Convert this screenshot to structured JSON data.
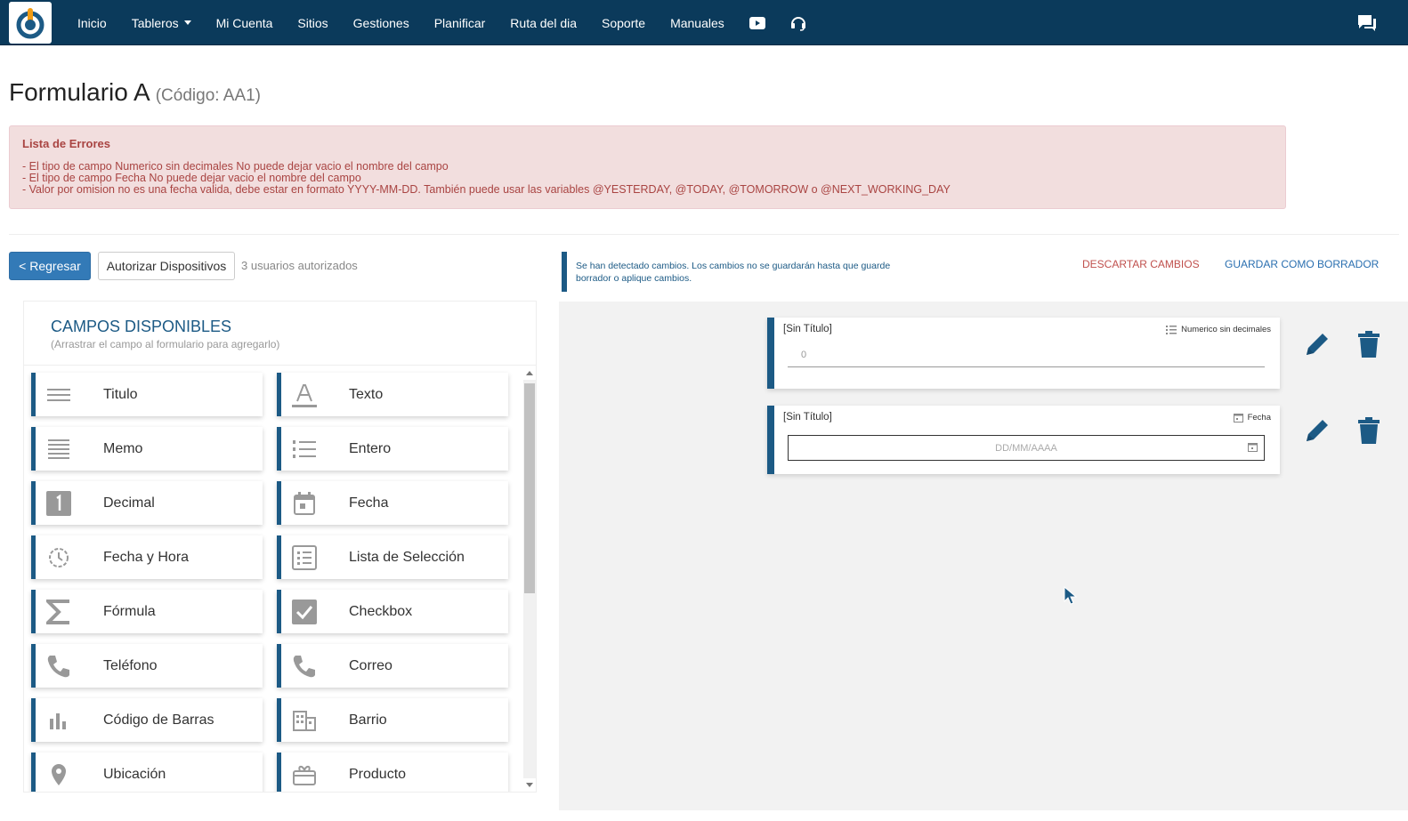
{
  "nav": {
    "items": [
      {
        "label": "Inicio"
      },
      {
        "label": "Tableros"
      },
      {
        "label": "Mi Cuenta"
      },
      {
        "label": "Sitios"
      },
      {
        "label": "Gestiones"
      },
      {
        "label": "Planificar"
      },
      {
        "label": "Ruta del dia"
      },
      {
        "label": "Soporte"
      },
      {
        "label": "Manuales"
      }
    ],
    "icons": [
      "youtube-icon",
      "headset-icon",
      "chat-icon"
    ]
  },
  "page": {
    "title": "Formulario A",
    "code": "(Código: AA1)"
  },
  "errors": {
    "title": "Lista de Errores",
    "lines": [
      "- El tipo de campo Numerico sin decimales No puede dejar vacio el nombre del campo",
      "- El tipo de campo Fecha No puede dejar vacio el nombre del campo",
      "- Valor por omision no es una fecha valida, debe estar en formato YYYY-MM-DD. También puede usar las variables @YESTERDAY, @TODAY, @TOMORROW o @NEXT_WORKING_DAY"
    ]
  },
  "toolbar": {
    "back_label": "< Regresar",
    "auth_label": "Autorizar Dispositivos",
    "auth_count": "3 usuarios autorizados"
  },
  "panel": {
    "title": "CAMPOS DISPONIBLES",
    "subtitle": "(Arrastrar el campo al formulario para agregarlo)",
    "fields": [
      {
        "label": "Titulo",
        "icon": "lines-icon"
      },
      {
        "label": "Texto",
        "icon": "text-a-icon"
      },
      {
        "label": "Memo",
        "icon": "memo-icon"
      },
      {
        "label": "Entero",
        "icon": "list-number-icon"
      },
      {
        "label": "Decimal",
        "icon": "number-one-icon"
      },
      {
        "label": "Fecha",
        "icon": "calendar-icon"
      },
      {
        "label": "Fecha y Hora",
        "icon": "clock-icon"
      },
      {
        "label": "Lista de Selección",
        "icon": "select-list-icon"
      },
      {
        "label": "Fórmula",
        "icon": "sigma-icon"
      },
      {
        "label": "Checkbox",
        "icon": "checkbox-icon"
      },
      {
        "label": "Teléfono",
        "icon": "phone-icon"
      },
      {
        "label": "Correo",
        "icon": "phone-icon"
      },
      {
        "label": "Código de Barras",
        "icon": "barcode-icon"
      },
      {
        "label": "Barrio",
        "icon": "building-icon"
      },
      {
        "label": "Ubicación",
        "icon": "location-pin-icon"
      },
      {
        "label": "Producto",
        "icon": "product-icon"
      }
    ]
  },
  "notice": {
    "line1": "Se han detectado cambios. Los cambios no se guardarán hasta que guarde",
    "line2": "borrador o aplique cambios."
  },
  "actions": {
    "discard_label": "DESCARTAR CAMBIOS",
    "draft_label": "GUARDAR COMO BORRADOR"
  },
  "form_fields": [
    {
      "title": "[Sin Título]",
      "type": "Numerico sin decimales",
      "value": "0"
    },
    {
      "title": "[Sin Título]",
      "type": "Fecha",
      "placeholder": "DD/MM/AAAA"
    }
  ],
  "colors": {
    "navbar": "#0b3a5b",
    "accent": "#1c5a85",
    "primary_button": "#337ab7",
    "error_bg": "#f2dede",
    "error_text": "#a94442",
    "discard": "#c0504d",
    "draft": "#2a6fb0"
  }
}
